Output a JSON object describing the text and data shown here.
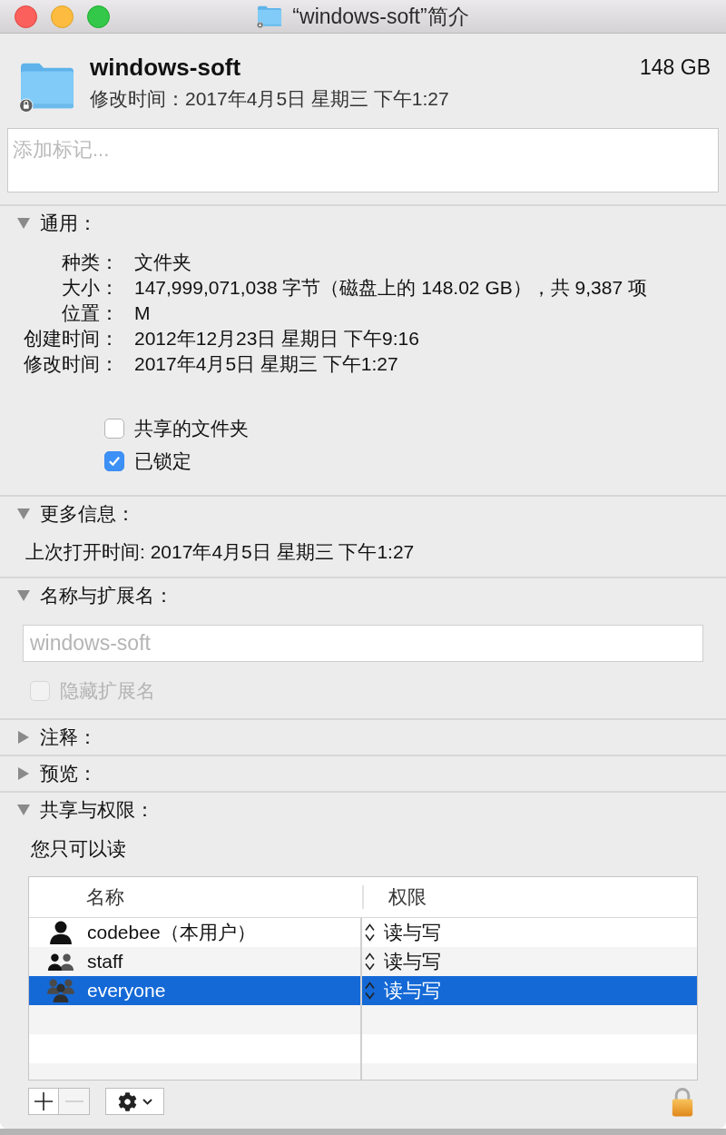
{
  "window": {
    "title": "“windows-soft”简介"
  },
  "header": {
    "name": "windows-soft",
    "modified": "修改时间：2017年4月5日 星期三 下午1:27",
    "size": "148 GB"
  },
  "tags_field": {
    "placeholder": "添加标记..."
  },
  "sections": [
    {
      "kind": "general",
      "title": "通用：",
      "expanded": true,
      "fields": [
        {
          "label": "种类：",
          "value": "文件夹"
        },
        {
          "label": "大小：",
          "value": "147,999,071,038 字节（磁盘上的 148.02 GB），共 9,387 项"
        },
        {
          "label": "位置：",
          "value": "M"
        },
        {
          "label": "创建时间：",
          "value": "2012年12月23日 星期日 下午9:16"
        },
        {
          "label": "修改时间：",
          "value": "2017年4月5日 星期三 下午1:27"
        }
      ],
      "options": [
        {
          "label": "共享的文件夹",
          "checked": false
        },
        {
          "label": "已锁定",
          "checked": true
        }
      ]
    },
    {
      "kind": "more_info",
      "title": "更多信息：",
      "expanded": true,
      "text": "上次打开时间: 2017年4月5日 星期三 下午1:27"
    },
    {
      "kind": "name_extension",
      "title": "名称与扩展名：",
      "expanded": true,
      "name_field": {
        "value": "windows-soft",
        "disabled": true
      },
      "hide_extension": {
        "label": "隐藏扩展名",
        "checked": false,
        "disabled": true
      }
    },
    {
      "kind": "comments",
      "title": "注释：",
      "expanded": false
    },
    {
      "kind": "preview",
      "title": "预览：",
      "expanded": false
    },
    {
      "kind": "sharing",
      "title": "共享与权限：",
      "expanded": true,
      "note": "您只可以读",
      "table": {
        "columns": [
          "名称",
          "权限"
        ],
        "rows": [
          {
            "kind": "user",
            "name": "codebee（本用户）",
            "privilege": "读与写",
            "selected": false
          },
          {
            "kind": "group",
            "name": "staff",
            "privilege": "读与写",
            "selected": false
          },
          {
            "kind": "everyone",
            "name": "everyone",
            "privilege": "读与写",
            "selected": true
          }
        ]
      },
      "buttons": [
        {
          "kind": "add",
          "disabled": false
        },
        {
          "kind": "remove",
          "disabled": true
        },
        {
          "kind": "action",
          "disabled": false
        }
      ],
      "lock": {
        "locked": true
      }
    }
  ]
}
